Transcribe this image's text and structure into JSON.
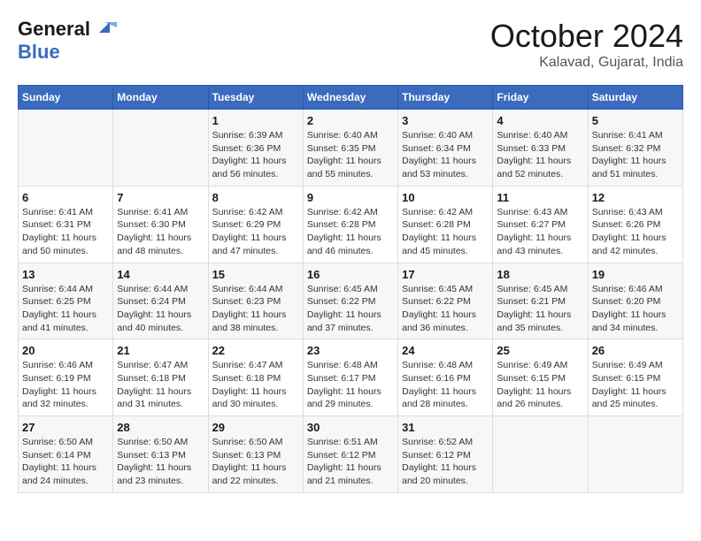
{
  "header": {
    "logo_line1": "General",
    "logo_line2": "Blue",
    "month_year": "October 2024",
    "location": "Kalavad, Gujarat, India"
  },
  "columns": [
    "Sunday",
    "Monday",
    "Tuesday",
    "Wednesday",
    "Thursday",
    "Friday",
    "Saturday"
  ],
  "weeks": [
    [
      {
        "day": "",
        "info": ""
      },
      {
        "day": "",
        "info": ""
      },
      {
        "day": "1",
        "info": "Sunrise: 6:39 AM\nSunset: 6:36 PM\nDaylight: 11 hours and 56 minutes."
      },
      {
        "day": "2",
        "info": "Sunrise: 6:40 AM\nSunset: 6:35 PM\nDaylight: 11 hours and 55 minutes."
      },
      {
        "day": "3",
        "info": "Sunrise: 6:40 AM\nSunset: 6:34 PM\nDaylight: 11 hours and 53 minutes."
      },
      {
        "day": "4",
        "info": "Sunrise: 6:40 AM\nSunset: 6:33 PM\nDaylight: 11 hours and 52 minutes."
      },
      {
        "day": "5",
        "info": "Sunrise: 6:41 AM\nSunset: 6:32 PM\nDaylight: 11 hours and 51 minutes."
      }
    ],
    [
      {
        "day": "6",
        "info": "Sunrise: 6:41 AM\nSunset: 6:31 PM\nDaylight: 11 hours and 50 minutes."
      },
      {
        "day": "7",
        "info": "Sunrise: 6:41 AM\nSunset: 6:30 PM\nDaylight: 11 hours and 48 minutes."
      },
      {
        "day": "8",
        "info": "Sunrise: 6:42 AM\nSunset: 6:29 PM\nDaylight: 11 hours and 47 minutes."
      },
      {
        "day": "9",
        "info": "Sunrise: 6:42 AM\nSunset: 6:28 PM\nDaylight: 11 hours and 46 minutes."
      },
      {
        "day": "10",
        "info": "Sunrise: 6:42 AM\nSunset: 6:28 PM\nDaylight: 11 hours and 45 minutes."
      },
      {
        "day": "11",
        "info": "Sunrise: 6:43 AM\nSunset: 6:27 PM\nDaylight: 11 hours and 43 minutes."
      },
      {
        "day": "12",
        "info": "Sunrise: 6:43 AM\nSunset: 6:26 PM\nDaylight: 11 hours and 42 minutes."
      }
    ],
    [
      {
        "day": "13",
        "info": "Sunrise: 6:44 AM\nSunset: 6:25 PM\nDaylight: 11 hours and 41 minutes."
      },
      {
        "day": "14",
        "info": "Sunrise: 6:44 AM\nSunset: 6:24 PM\nDaylight: 11 hours and 40 minutes."
      },
      {
        "day": "15",
        "info": "Sunrise: 6:44 AM\nSunset: 6:23 PM\nDaylight: 11 hours and 38 minutes."
      },
      {
        "day": "16",
        "info": "Sunrise: 6:45 AM\nSunset: 6:22 PM\nDaylight: 11 hours and 37 minutes."
      },
      {
        "day": "17",
        "info": "Sunrise: 6:45 AM\nSunset: 6:22 PM\nDaylight: 11 hours and 36 minutes."
      },
      {
        "day": "18",
        "info": "Sunrise: 6:45 AM\nSunset: 6:21 PM\nDaylight: 11 hours and 35 minutes."
      },
      {
        "day": "19",
        "info": "Sunrise: 6:46 AM\nSunset: 6:20 PM\nDaylight: 11 hours and 34 minutes."
      }
    ],
    [
      {
        "day": "20",
        "info": "Sunrise: 6:46 AM\nSunset: 6:19 PM\nDaylight: 11 hours and 32 minutes."
      },
      {
        "day": "21",
        "info": "Sunrise: 6:47 AM\nSunset: 6:18 PM\nDaylight: 11 hours and 31 minutes."
      },
      {
        "day": "22",
        "info": "Sunrise: 6:47 AM\nSunset: 6:18 PM\nDaylight: 11 hours and 30 minutes."
      },
      {
        "day": "23",
        "info": "Sunrise: 6:48 AM\nSunset: 6:17 PM\nDaylight: 11 hours and 29 minutes."
      },
      {
        "day": "24",
        "info": "Sunrise: 6:48 AM\nSunset: 6:16 PM\nDaylight: 11 hours and 28 minutes."
      },
      {
        "day": "25",
        "info": "Sunrise: 6:49 AM\nSunset: 6:15 PM\nDaylight: 11 hours and 26 minutes."
      },
      {
        "day": "26",
        "info": "Sunrise: 6:49 AM\nSunset: 6:15 PM\nDaylight: 11 hours and 25 minutes."
      }
    ],
    [
      {
        "day": "27",
        "info": "Sunrise: 6:50 AM\nSunset: 6:14 PM\nDaylight: 11 hours and 24 minutes."
      },
      {
        "day": "28",
        "info": "Sunrise: 6:50 AM\nSunset: 6:13 PM\nDaylight: 11 hours and 23 minutes."
      },
      {
        "day": "29",
        "info": "Sunrise: 6:50 AM\nSunset: 6:13 PM\nDaylight: 11 hours and 22 minutes."
      },
      {
        "day": "30",
        "info": "Sunrise: 6:51 AM\nSunset: 6:12 PM\nDaylight: 11 hours and 21 minutes."
      },
      {
        "day": "31",
        "info": "Sunrise: 6:52 AM\nSunset: 6:12 PM\nDaylight: 11 hours and 20 minutes."
      },
      {
        "day": "",
        "info": ""
      },
      {
        "day": "",
        "info": ""
      }
    ]
  ]
}
